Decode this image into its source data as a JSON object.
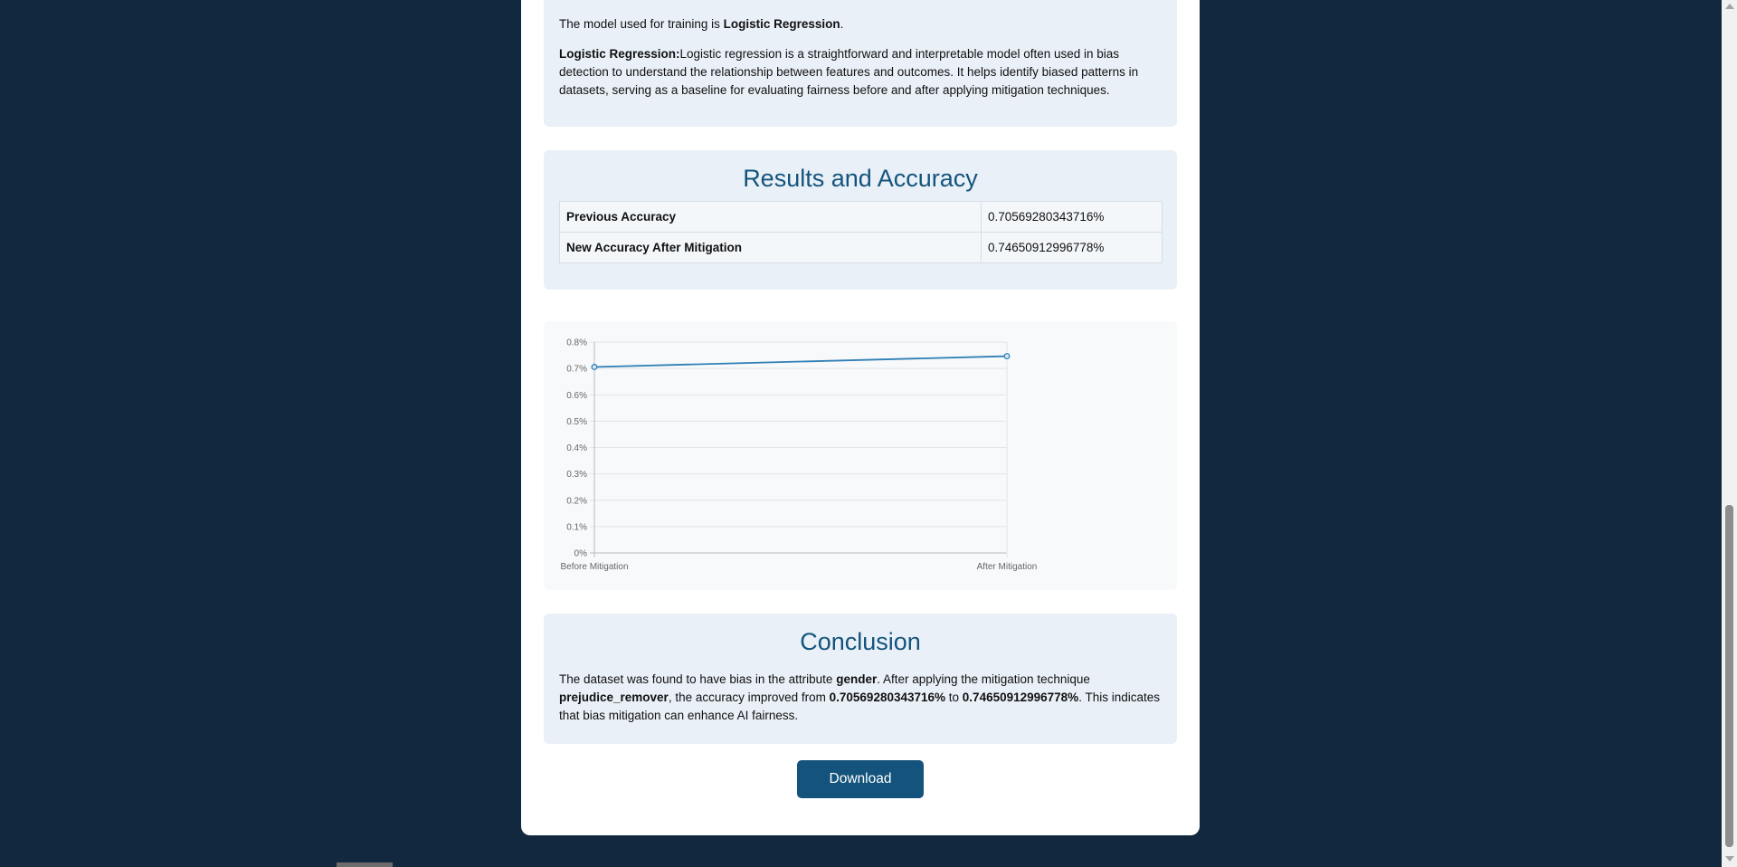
{
  "model": {
    "intro": "The model used for training is ",
    "model_name": "Logistic Regression",
    "intro_end": ".",
    "desc_title": "Logistic Regression:",
    "desc_text": "Logistic regression is a straightforward and interpretable model often used in bias detection to understand the relationship between features and outcomes. It helps identify biased patterns in datasets, serving as a baseline for evaluating fairness before and after applying mitigation techniques."
  },
  "results": {
    "title": "Results and Accuracy",
    "rows": [
      {
        "label": "Previous Accuracy",
        "value": "0.70569280343716%"
      },
      {
        "label": "New Accuracy After Mitigation",
        "value": "0.74650912996778%"
      }
    ]
  },
  "chart_data": {
    "type": "line",
    "categories": [
      "Before Mitigation",
      "After Mitigation"
    ],
    "series": [
      {
        "values": [
          0.70569280343716,
          0.74650912996778
        ]
      }
    ],
    "y_ticks": [
      "0%",
      "0.1%",
      "0.2%",
      "0.3%",
      "0.4%",
      "0.5%",
      "0.6%",
      "0.7%",
      "0.8%"
    ],
    "ylim": [
      0,
      0.8
    ],
    "grid": true,
    "line_color": "#2f7fb5"
  },
  "conclusion": {
    "title": "Conclusion",
    "t1": "The dataset was found to have bias in the attribute ",
    "attribute": "gender",
    "t2": ". After applying the mitigation technique ",
    "technique": "prejudice_remover",
    "t3": ", the accuracy improved from ",
    "before": "0.70569280343716%",
    "t4": " to ",
    "after": "0.74650912996778%",
    "t5": ". This indicates that bias mitigation can enhance AI fairness."
  },
  "download_label": "Download"
}
